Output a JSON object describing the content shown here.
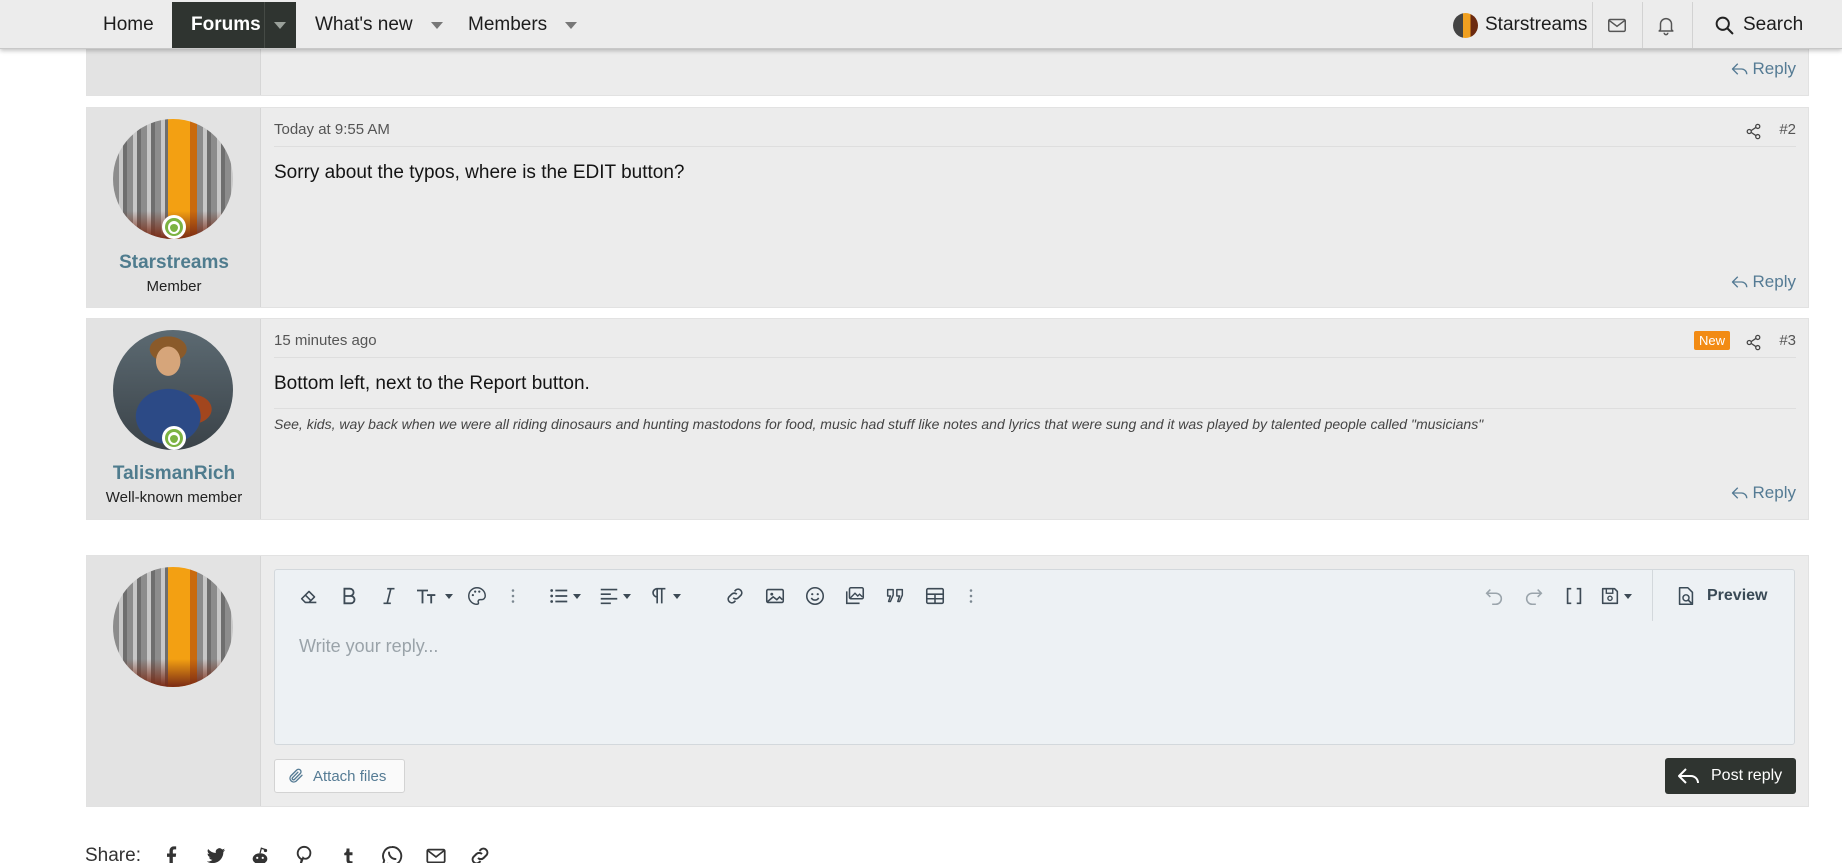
{
  "nav": {
    "home": "Home",
    "forums": "Forums",
    "whats_new": "What's new",
    "members": "Members",
    "username": "Starstreams",
    "search": "Search",
    "inbox_icon": "envelope-icon",
    "alerts_icon": "bell-icon"
  },
  "posts": [
    {
      "reply": "Reply"
    },
    {
      "date": "Today at 9:55 AM",
      "number": "#2",
      "body": "Sorry about the typos, where is the EDIT button?",
      "username": "Starstreams",
      "usertitle": "Member",
      "reply": "Reply"
    },
    {
      "date": "15 minutes ago",
      "badge": "New",
      "number": "#3",
      "body": "Bottom left, next to the Report button.",
      "signature": "See, kids, way back when we were all riding dinosaurs and hunting mastodons for food, music had stuff like notes and lyrics that were sung and it was played by talented people called \"musicians\"",
      "username": "TalismanRich",
      "usertitle": "Well-known member",
      "reply": "Reply"
    }
  ],
  "editor": {
    "placeholder": "Write your reply...",
    "preview": "Preview",
    "attach": "Attach files",
    "post_reply": "Post reply"
  },
  "share": {
    "label": "Share:",
    "targets": [
      "facebook-icon",
      "twitter-icon",
      "reddit-icon",
      "pinterest-icon",
      "tumblr-icon",
      "whatsapp-icon",
      "email-icon",
      "link-icon"
    ]
  },
  "colors": {
    "accent": "#557b94",
    "username": "#4f7c8e",
    "nav_active": "#2f3430",
    "badge_new": "#f28b14",
    "online": "#7cb342"
  }
}
